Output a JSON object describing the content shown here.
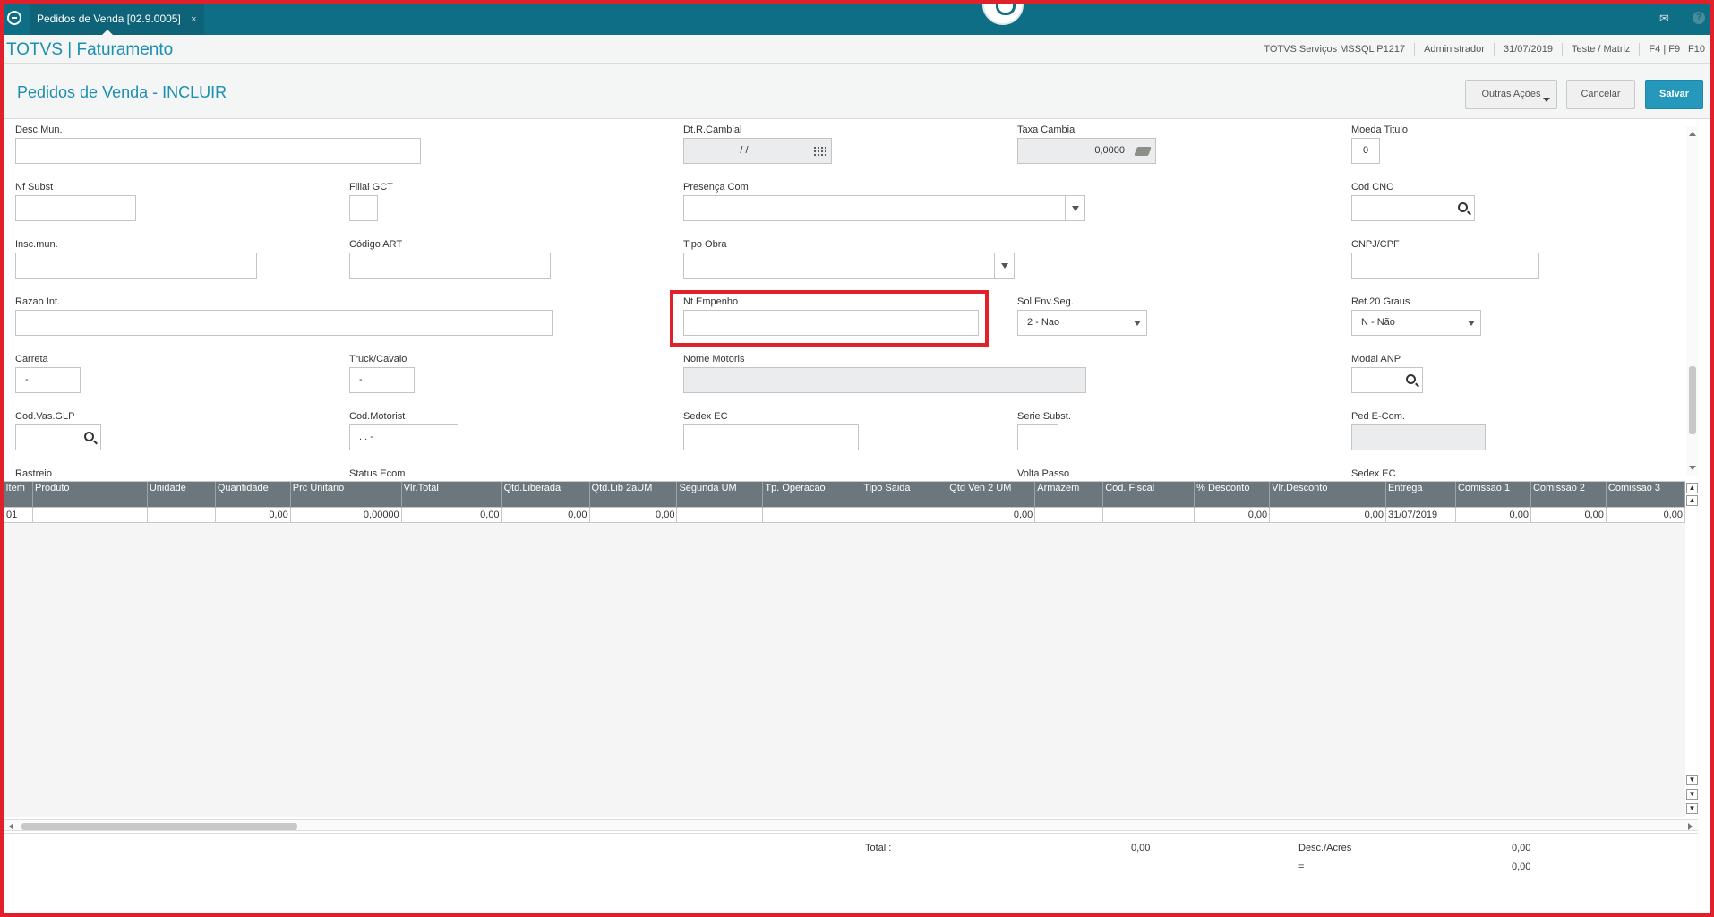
{
  "topbar": {
    "tab_label": "Pedidos de Venda [02.9.0005]",
    "tab_close": "×",
    "mail_icon": "✉",
    "help_icon": "?"
  },
  "appbar": {
    "title": "TOTVS | Faturamento",
    "environment": "TOTVS Serviços MSSQL P1217",
    "user": "Administrador",
    "date": "31/07/2019",
    "company": "Teste / Matriz",
    "shortcuts": "F4 | F9 | F10"
  },
  "page": {
    "title": "Pedidos de Venda - INCLUIR",
    "btn_other": "Outras Ações",
    "btn_cancel": "Cancelar",
    "btn_save": "Salvar"
  },
  "form": {
    "desc_mun": {
      "label": "Desc.Mun.",
      "value": ""
    },
    "dt_r_cambial": {
      "label": "Dt.R.Cambial",
      "value": "/ /"
    },
    "taxa_cambial": {
      "label": "Taxa Cambial",
      "value": "0,0000"
    },
    "moeda_titulo": {
      "label": "Moeda Titulo",
      "value": "0"
    },
    "nf_subst": {
      "label": "Nf Subst",
      "value": ""
    },
    "filial_gct": {
      "label": "Filial GCT",
      "value": ""
    },
    "presenca_com": {
      "label": "Presença Com",
      "value": ""
    },
    "cod_cno": {
      "label": "Cod CNO",
      "value": ""
    },
    "insc_mun": {
      "label": "Insc.mun.",
      "value": ""
    },
    "codigo_art": {
      "label": "Código ART",
      "value": ""
    },
    "tipo_obra": {
      "label": "Tipo Obra",
      "value": ""
    },
    "cnpj_cpf": {
      "label": "CNPJ/CPF",
      "value": ""
    },
    "razao_int": {
      "label": "Razao Int.",
      "value": ""
    },
    "nt_empenho": {
      "label": "Nt Empenho",
      "value": ""
    },
    "sol_env_seg": {
      "label": "Sol.Env.Seg.",
      "value": "2 - Nao"
    },
    "ret_20_graus": {
      "label": "Ret.20 Graus",
      "value": "N - Não"
    },
    "carreta": {
      "label": "Carreta",
      "value": "-"
    },
    "truck_cavalo": {
      "label": "Truck/Cavalo",
      "value": "-"
    },
    "nome_motoris": {
      "label": "Nome Motoris",
      "value": ""
    },
    "modal_anp": {
      "label": "Modal ANP",
      "value": ""
    },
    "cod_vas_glp": {
      "label": "Cod.Vas.GLP",
      "value": ""
    },
    "cod_motorist": {
      "label": "Cod.Motorist",
      "value": ".  .  -"
    },
    "sedex_ec": {
      "label": "Sedex EC",
      "value": ""
    },
    "serie_subst": {
      "label": "Serie Subst.",
      "value": ""
    },
    "ped_ecom": {
      "label": "Ped E-Com.",
      "value": ""
    },
    "rastreio": {
      "label": "Rastreio"
    },
    "status_ecom": {
      "label": "Status Ecom"
    },
    "volta_passo": {
      "label": "Volta Passo"
    },
    "sedex_ec_2": {
      "label": "Sedex EC"
    }
  },
  "grid": {
    "columns": [
      "Item",
      "Produto",
      "Unidade",
      "Quantidade",
      "Prc Unitario",
      "Vlr.Total",
      "Qtd.Liberada",
      "Qtd.Lib 2aUM",
      "Segunda UM",
      "Tp. Operacao",
      "Tipo Saida",
      "Qtd Ven 2 UM",
      "Armazem",
      "Cod. Fiscal",
      "% Desconto",
      "Vlr.Desconto",
      "Entrega",
      "Comissao 1",
      "Comissao 2",
      "Comissao 3"
    ],
    "rows": [
      [
        "01",
        "",
        "",
        "0,00",
        "0,00000",
        "0,00",
        "0,00",
        "0,00",
        "",
        "",
        "",
        "0,00",
        "",
        "",
        "0,00",
        "0,00",
        "31/07/2019",
        "0,00",
        "0,00",
        "0,00"
      ]
    ]
  },
  "totals": {
    "total_label": "Total :",
    "total_value": "0,00",
    "desc_label": "Desc./Acres",
    "desc_value": "0,00",
    "eq_label": "=",
    "eq_value": "0,00"
  }
}
